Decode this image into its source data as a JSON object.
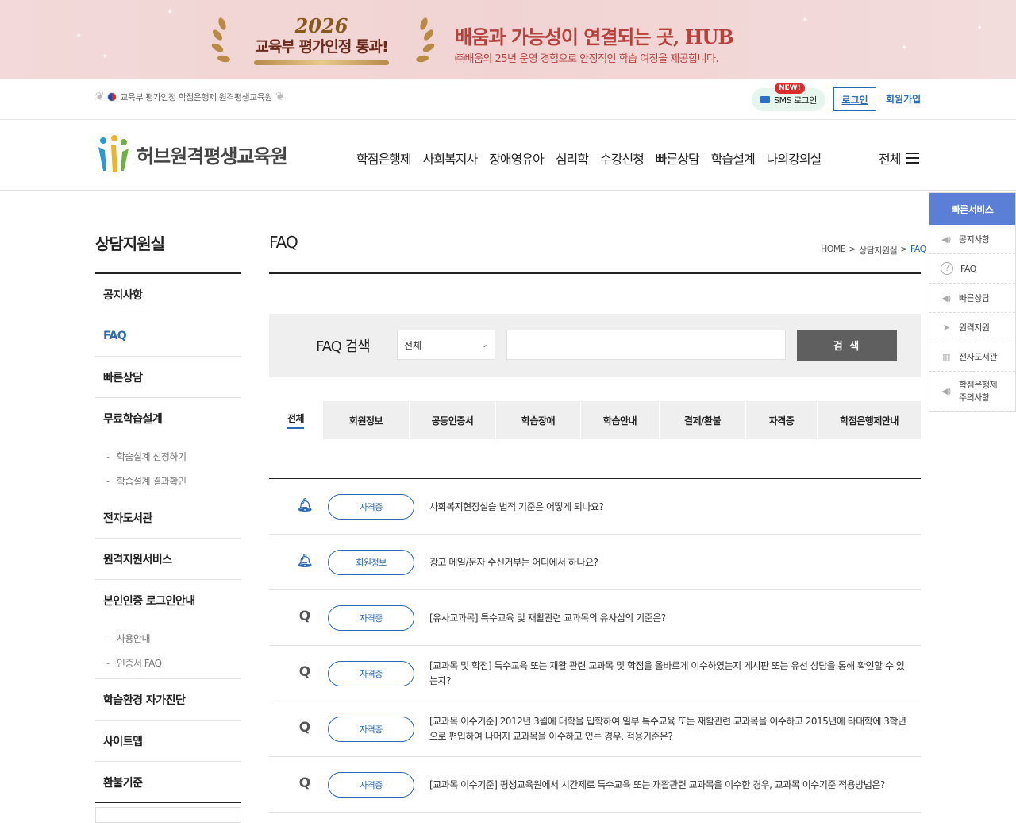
{
  "banner": {
    "year": "2026",
    "badge": "교육부 평가인정 통과!",
    "headline": "배움과 가능성이 연결되는 곳, HUB",
    "sub": "㈜배움의 25년 운영 경험으로 안정적인 학습 여정을 제공합니다."
  },
  "util": {
    "cert_text": "교육부 평가인정 학점은행제 원격평생교육원",
    "new_badge": "NEW!",
    "sms_login": "SMS 로그인",
    "login": "로그인",
    "join": "회원가입"
  },
  "header": {
    "logo_text": "허브원격평생교육원",
    "gnb": [
      "학점은행제",
      "사회복지사",
      "장애영유아",
      "심리학",
      "수강신청",
      "빠른상담",
      "학습설계",
      "나의강의실"
    ],
    "all_menu": "전체"
  },
  "quick": {
    "title": "빠른서비스",
    "items": [
      "공지사항",
      "FAQ",
      "빠른상담",
      "원격지원",
      "전자도서관",
      "학점은행제 주의사항"
    ],
    "icons": [
      "speaker-icon",
      "question-icon",
      "speaker-icon",
      "cursor-icon",
      "book-icon",
      "speaker-icon"
    ]
  },
  "sidebar": {
    "title": "상담지원실",
    "items": [
      {
        "label": "공지사항"
      },
      {
        "label": "FAQ"
      },
      {
        "label": "빠른상담"
      },
      {
        "label": "무료학습설계",
        "children": [
          "학습설계 신청하기",
          "학습설계 결과확인"
        ]
      },
      {
        "label": "전자도서관"
      },
      {
        "label": "원격지원서비스"
      },
      {
        "label": "본인인증 로그인안내",
        "children": [
          "사용안내",
          "인증서 FAQ"
        ]
      },
      {
        "label": "학습환경 자가진단"
      },
      {
        "label": "사이트맵"
      },
      {
        "label": "환불기준"
      }
    ],
    "active": "FAQ"
  },
  "main": {
    "title": "FAQ",
    "breadcrumb": [
      "HOME",
      "상담지원실",
      "FAQ"
    ],
    "search": {
      "label": "FAQ 검색",
      "select_value": "전체",
      "input_value": "",
      "button": "검 색"
    },
    "tabs": [
      "전체",
      "회원정보",
      "공동인증서",
      "학습장애",
      "학습안내",
      "결제/환불",
      "자격증",
      "학점은행제안내"
    ],
    "active_tab": "전체",
    "faqs": [
      {
        "mark": "bell",
        "category": "자격증",
        "question": "사회복지현장실습 법적 기준은 어떻게 되나요?"
      },
      {
        "mark": "bell",
        "category": "회원정보",
        "question": "광고 메일/문자 수신거부는 어디에서 하나요?"
      },
      {
        "mark": "Q",
        "category": "자격증",
        "question": "[유사교과목] 특수교육 및 재활관련 교과목의 유사심의 기준은?"
      },
      {
        "mark": "Q",
        "category": "자격증",
        "question": "[교과목 및 학점] 특수교육 또는 재활 관련 교과목 및 학점을 올바르게 이수하였는지 게시판 또는 유선 상담을 통해 확인할 수 있는지?"
      },
      {
        "mark": "Q",
        "category": "자격증",
        "question": "[교과목 이수기준] 2012년 3월에 대학을 입학하여 일부 특수교육 또는 재활관련 교과목을 이수하고 2015년에 타대학에 3학년으로 편입하여 나머지 교과목을 이수하고 있는 경우, 적용기준은?"
      },
      {
        "mark": "Q",
        "category": "자격증",
        "question": "[교과목 이수기준] 평생교육원에서 시간제로 특수교육 또는 재활관련 교과목을 이수한 경우, 교과목 이수기준 적용방법은?"
      }
    ]
  },
  "colors": {
    "accent": "#2a6ab8",
    "quick_header": "#5b7fd6",
    "banner_text": "#b8413b"
  }
}
